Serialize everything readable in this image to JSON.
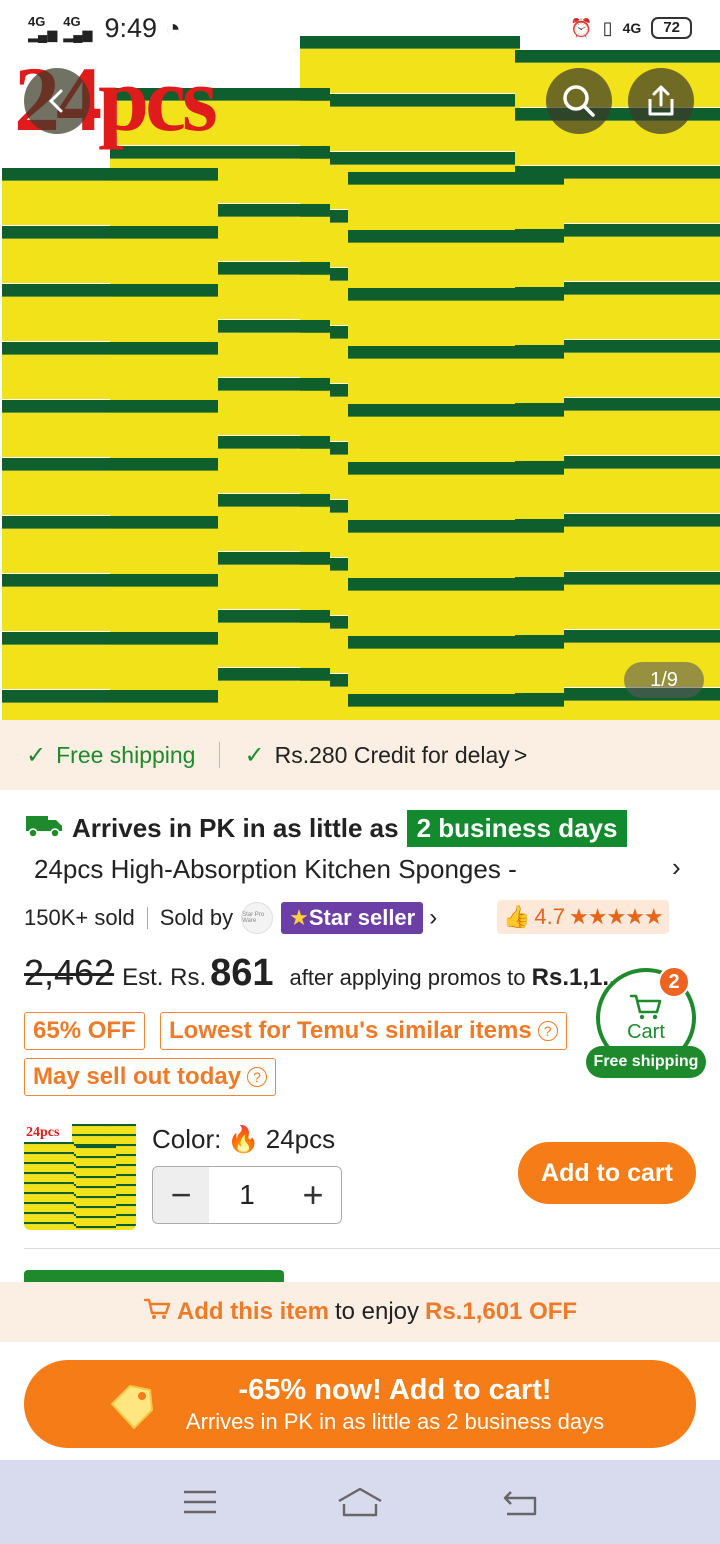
{
  "status_bar": {
    "signal1": "4G",
    "signal2": "4G",
    "time": "9:49",
    "net": "4G",
    "battery": "72"
  },
  "hero": {
    "logo_text": "24pcs",
    "image_counter": "1/9"
  },
  "shipping_band": {
    "free_shipping": "Free shipping",
    "credit": "Rs.280 Credit for delay",
    "chevron": ">"
  },
  "arrival": {
    "text": "Arrives in PK in as little as",
    "days": "2 business days"
  },
  "product": {
    "title": "24pcs High-Absorption Kitchen Sponges -",
    "sold": "150K+ sold",
    "sold_by_label": "Sold by",
    "seller_logo": "Star Pro Ware",
    "star_seller": "Star seller",
    "rating": "4.7",
    "stars": "★★★★★"
  },
  "price": {
    "original": "2,462",
    "est_label": "Est. Rs.",
    "current": "861",
    "after_promos": "after applying promos to",
    "promo_target": "Rs.1,1..."
  },
  "tags": {
    "discount": "65% OFF",
    "lowest": "Lowest for Temu's similar items",
    "sellout": "May sell out today"
  },
  "cart_float": {
    "badge": "2",
    "label": "Cart",
    "free_shipping": "Free shipping"
  },
  "variant": {
    "color_label": "Color:",
    "color_value": "24pcs",
    "quantity": "1",
    "add_to_cart": "Add to cart"
  },
  "promo_strip": {
    "cta": "Add this item",
    "middle": "to enjoy",
    "amount": "Rs.1,601 OFF"
  },
  "big_cta": {
    "line1": "-65% now! Add to cart!",
    "line2": "Arrives in PK in as little as 2 business days"
  },
  "colors": {
    "accent_orange": "#f57c16",
    "green": "#1e8a2c",
    "band_bg": "#fbeee2",
    "star_seller_purple": "#6b3fa6",
    "sponge_yellow": "#f2e21a",
    "sponge_green": "#0e5e2e"
  }
}
